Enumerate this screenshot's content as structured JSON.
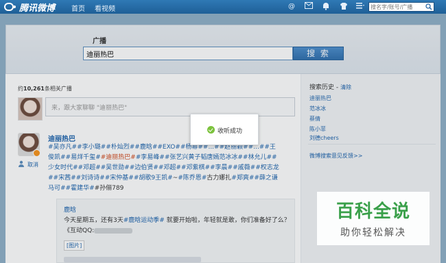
{
  "topbar": {
    "logo_text": "腾讯微博",
    "nav": [
      "首页",
      "看视频"
    ],
    "search_placeholder": "搜名字/账号/广播",
    "icons": [
      "at-icon",
      "mail-icon",
      "notification-icon",
      "skin-icon",
      "menu-icon",
      "search-icon"
    ]
  },
  "search": {
    "label": "广播",
    "query": "迪丽热巴",
    "button_label": "搜 索"
  },
  "results": {
    "count_prefix": "约",
    "count_value": "10,261",
    "count_suffix": "条相关广播",
    "compose_placeholder": "来，跟大家聊聊 \"迪丽热巴\""
  },
  "post": {
    "author": "迪丽热巴",
    "unfollow": "取消",
    "segments": [
      {
        "t": "#吴亦凡#",
        "c": "tag"
      },
      {
        "t": "#李小璐#",
        "c": "tag"
      },
      {
        "t": "#朴灿烈#",
        "c": "tag"
      },
      {
        "t": "#鹿晗#",
        "c": "tag"
      },
      {
        "t": "#EXO#",
        "c": "tag"
      },
      {
        "t": "#杨幂#",
        "c": "tag"
      },
      {
        "t": "#...#",
        "c": "tag"
      },
      {
        "t": "#赵丽颖#",
        "c": "tag"
      },
      {
        "t": "#...#",
        "c": "tag"
      },
      {
        "t": "#王俊凯#",
        "c": "tag"
      },
      {
        "t": "#易烊千玺#",
        "c": "tag"
      },
      {
        "t": "#迪丽热巴#",
        "c": "tag hl"
      },
      {
        "t": "#李易峰#",
        "c": "tag"
      },
      {
        "t": "#张艺兴黄子韬唐嫣范冰冰#",
        "c": "tag"
      },
      {
        "t": "#林允儿#",
        "c": "tag"
      },
      {
        "t": "#少女时代#",
        "c": "tag"
      },
      {
        "t": "#邓超#",
        "c": "tag"
      },
      {
        "t": "#吴世勋#",
        "c": "tag"
      },
      {
        "t": "#边伯贤#",
        "c": "tag"
      },
      {
        "t": "#邓超#",
        "c": "tag"
      },
      {
        "t": "#邓紫棋#",
        "c": "tag"
      },
      {
        "t": "#李晨#",
        "c": "tag"
      },
      {
        "t": "#戚薇#",
        "c": "tag"
      },
      {
        "t": "#权志龙#",
        "c": "tag"
      },
      {
        "t": "#宋茜#",
        "c": "tag"
      },
      {
        "t": "#刘诗诗#",
        "c": "tag"
      },
      {
        "t": "#宋仲基#",
        "c": "tag"
      },
      {
        "t": "#胡歌9王凯#",
        "c": "tag"
      },
      {
        "t": "~",
        "c": ""
      },
      {
        "t": "#陈乔恩#",
        "c": "tag"
      },
      {
        "t": "古力娜扎",
        "c": ""
      },
      {
        "t": "#郑爽#",
        "c": "tag"
      },
      {
        "t": "#薛之谦马可#",
        "c": "tag"
      },
      {
        "t": "#霍建华#",
        "c": "tag"
      },
      {
        "t": "#孙俪789",
        "c": ""
      }
    ]
  },
  "repost": {
    "author": "鹿晗",
    "text_before": "今天星期五，还有3天",
    "tag": "#鹿晗运动季#",
    "text_after": " 就要开始啦，年轻就是敢，你们准备好了么？《互动QQ:",
    "pic_label": "[图片]"
  },
  "sidebar": {
    "history_title": "搜索历史 -",
    "clear_label": "清除",
    "history": [
      "迪丽热巴",
      "范冰冰",
      "蔡倩",
      "陈小菲",
      "刘德cheers"
    ],
    "feedback": "微博搜索意见反馈>>"
  },
  "toast": {
    "text": "收听成功"
  },
  "watermark": {
    "title": "百科全说",
    "subtitle": "助你轻松解决"
  }
}
